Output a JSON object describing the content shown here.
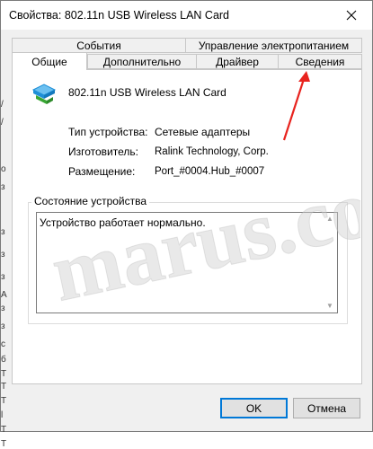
{
  "window": {
    "title": "Свойства: 802.11n USB Wireless LAN Card"
  },
  "left_strip": {
    "chars": [
      "/",
      "/",
      "o",
      "з",
      "з",
      "з",
      "з",
      "A",
      "з",
      "з",
      "c",
      "б",
      "Т",
      "Т",
      "Т",
      "l",
      "Т",
      "Т"
    ]
  },
  "tabs": {
    "row1": [
      "События",
      "Управление электропитанием"
    ],
    "row2": [
      "Общие",
      "Дополнительно",
      "Драйвер",
      "Сведения"
    ],
    "active": "Общие"
  },
  "device": {
    "icon": "network-adapter-icon",
    "name": "802.11n USB Wireless LAN Card"
  },
  "properties": [
    {
      "label": "Тип устройства:",
      "value": "Сетевые адаптеры"
    },
    {
      "label": "Изготовитель:",
      "value": "Ralink Technology, Corp."
    },
    {
      "label": "Размещение:",
      "value": "Port_#0004.Hub_#0007"
    }
  ],
  "status": {
    "group_title": "Состояние устройства",
    "text": "Устройство работает нормально."
  },
  "buttons": {
    "ok": "OK",
    "cancel": "Отмена"
  },
  "watermark": {
    "text": "marus.com"
  },
  "colors": {
    "accent": "#0078d7",
    "arrow": "#e8231e",
    "icon_blue": "#1e8fd8",
    "icon_green": "#3aa635"
  }
}
